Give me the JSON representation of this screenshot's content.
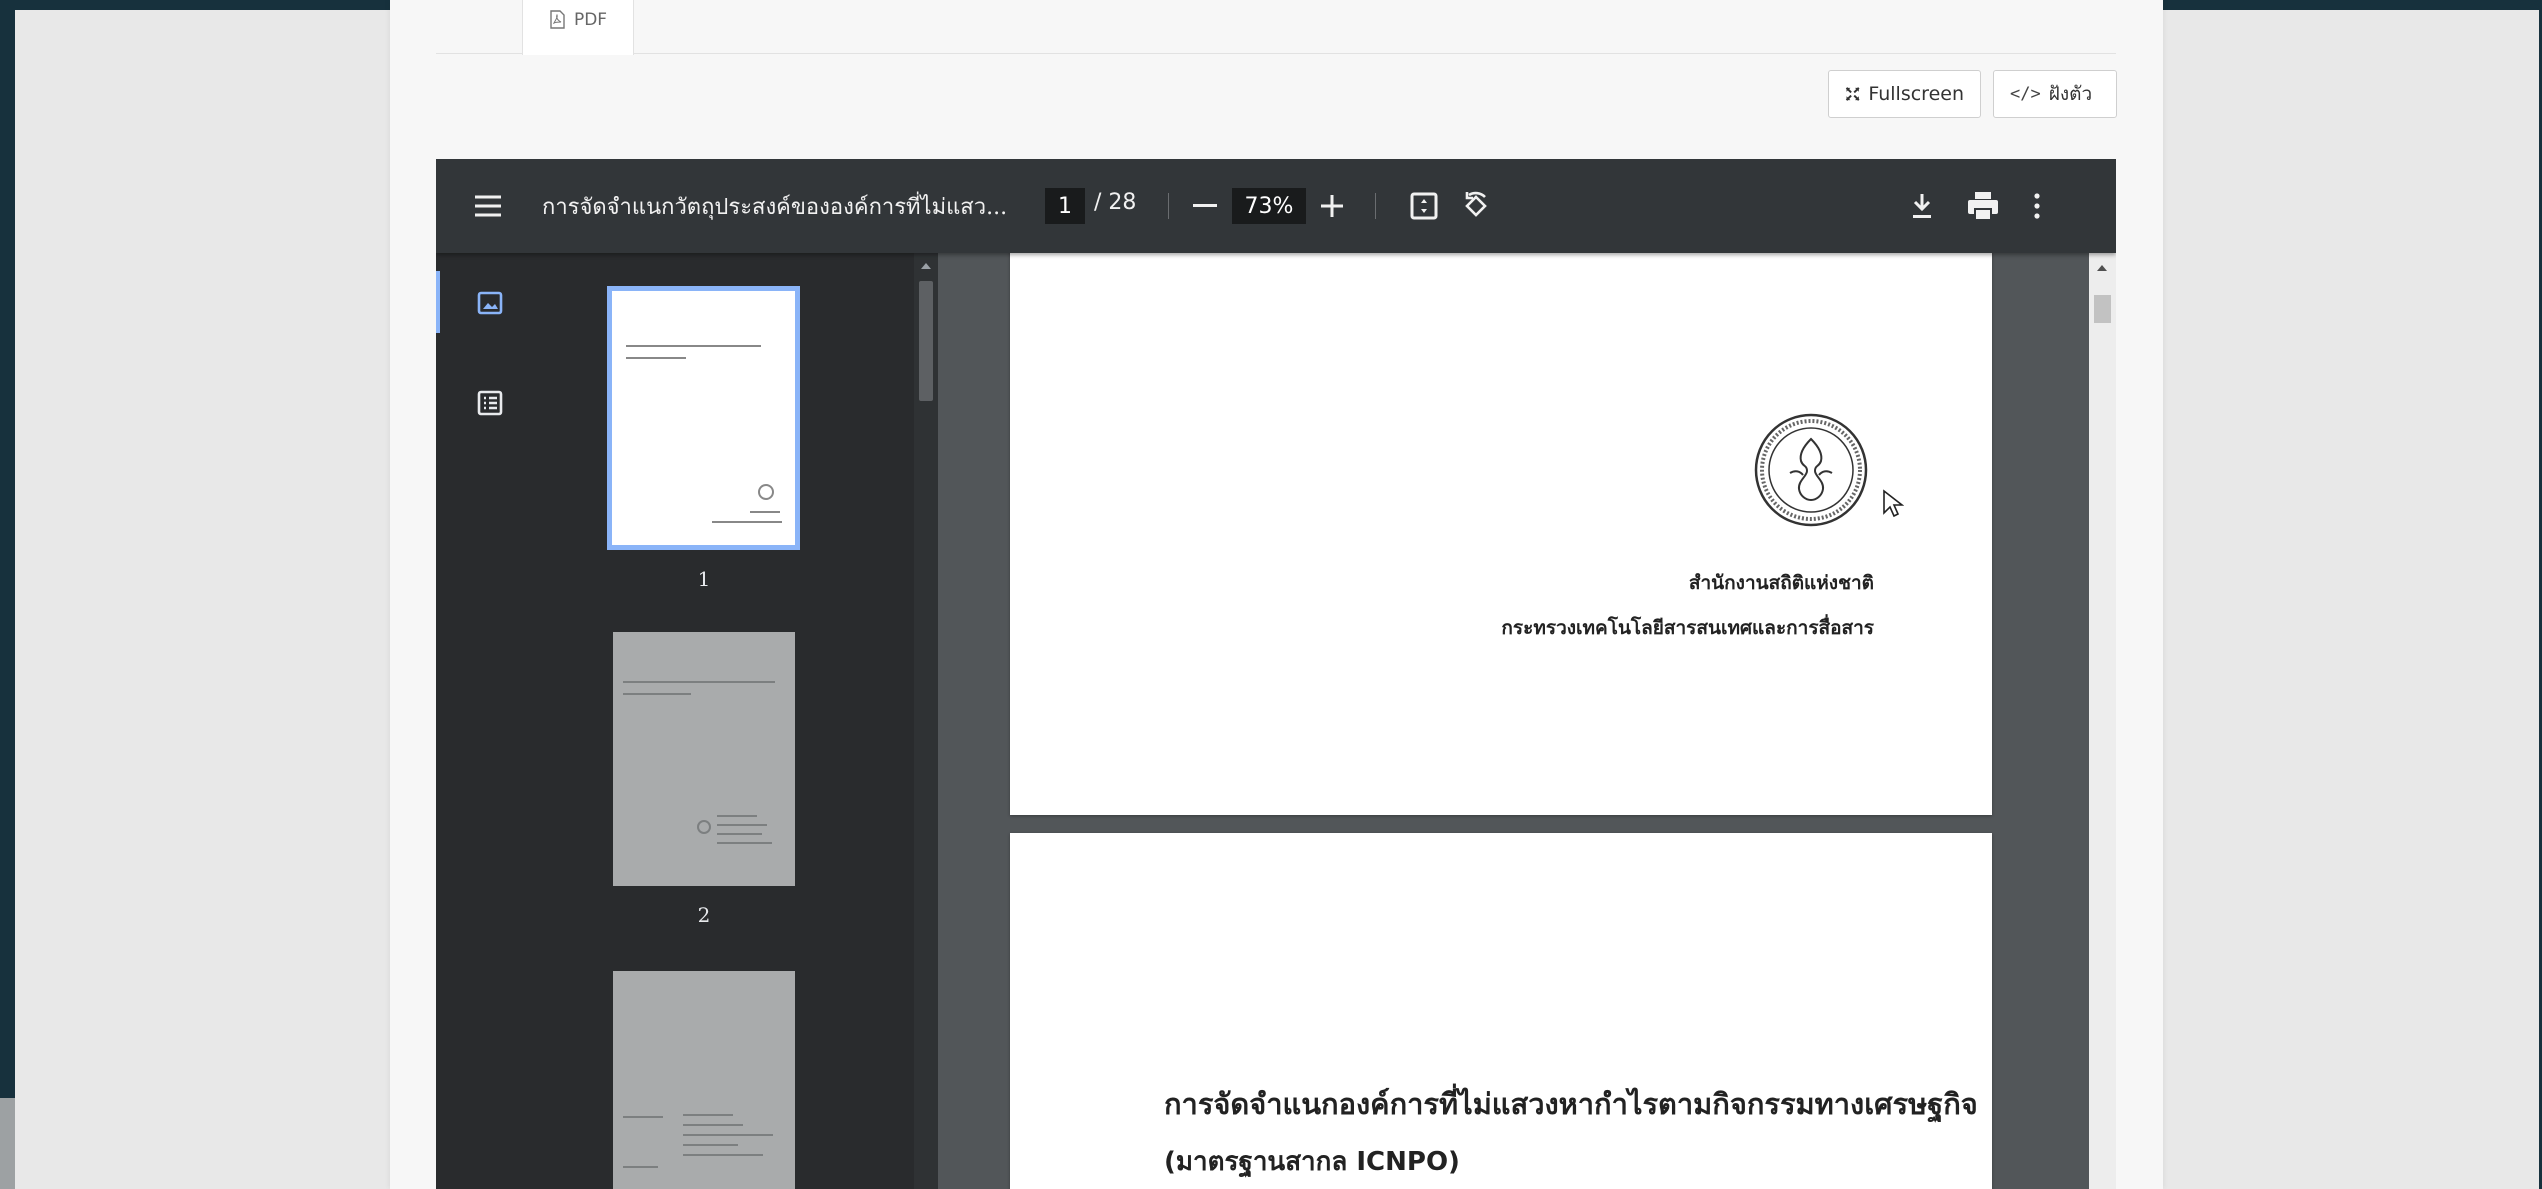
{
  "tab": {
    "label": "PDF",
    "icon": "pdf-file-icon"
  },
  "actions": {
    "fullscreen_label": "Fullscreen",
    "embed_label": "ฝังตัว"
  },
  "viewer": {
    "doc_title": "การจัดจำแนกวัตถุประสงค์ขององค์การที่ไม่แสว...",
    "current_page": "1",
    "page_total": "/ 28",
    "zoom": "73%",
    "icons": [
      "menu-icon",
      "zoom-out-icon",
      "zoom-in-icon",
      "fit-page-icon",
      "rotate-icon",
      "download-icon",
      "print-icon",
      "more-options-icon",
      "thumbnails-icon",
      "outline-icon"
    ]
  },
  "thumbnails": [
    {
      "label": "1",
      "selected": true
    },
    {
      "label": "2",
      "selected": false
    }
  ],
  "page1": {
    "org_name": "สำนักงานสถิติแห่งชาติ",
    "ministry": "กระทรวงเทคโนโลยีสารสนเทศและการสื่อสาร",
    "seal": "nso-seal-icon"
  },
  "page2": {
    "title": "การจัดจำแนกองค์การที่ไม่แสวงหากำไรตามกิจกรรมทางเศรษฐกิจ",
    "subtitle": "(มาตรฐานสากล ICNPO)"
  },
  "colors": {
    "toolbar": "#323639",
    "sidebar": "#292b2d",
    "content": "#525659",
    "accent": "#8ab4f8",
    "frame": "#17313d"
  }
}
